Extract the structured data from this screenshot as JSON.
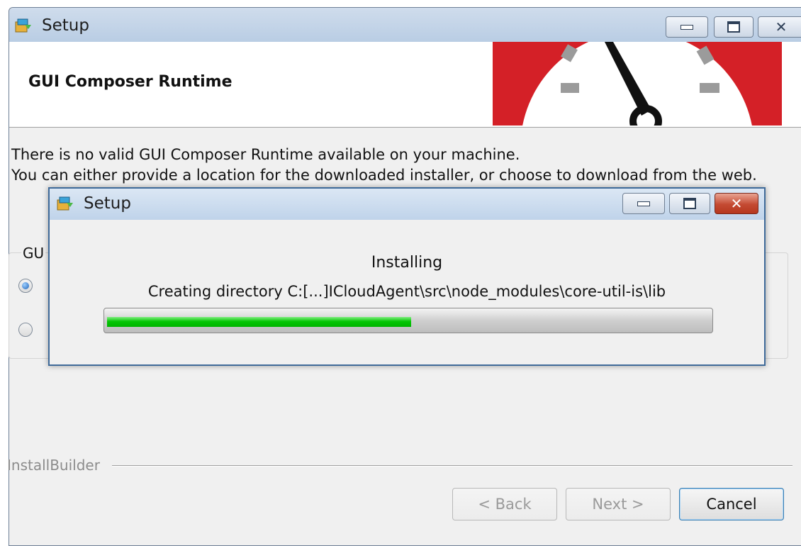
{
  "main_window": {
    "title": "Setup",
    "header_title": "GUI Composer Runtime",
    "message_line1": "There is no valid GUI Composer Runtime available on your machine.",
    "message_line2": "You can either provide a location for the downloaded installer, or choose to download from the web.",
    "group_label": "GU",
    "radio_options": [
      {
        "selected": true
      },
      {
        "selected": false
      }
    ],
    "footer_brand": "InstallBuilder",
    "buttons": {
      "back": "< Back",
      "next": "Next >",
      "cancel": "Cancel"
    },
    "controls": {
      "close_glyph": "✕"
    }
  },
  "install_dialog": {
    "title": "Setup",
    "status_title": "Installing",
    "status_detail": "Creating directory C:[...]ICloudAgent\\src\\node_modules\\core-util-is\\lib",
    "progress_fraction": 0.505,
    "controls": {
      "close_glyph": "✕"
    }
  },
  "colors": {
    "progress_green": "#06c606",
    "banner_red": "#d42027",
    "titlebar_blue": "#b9cde4"
  }
}
